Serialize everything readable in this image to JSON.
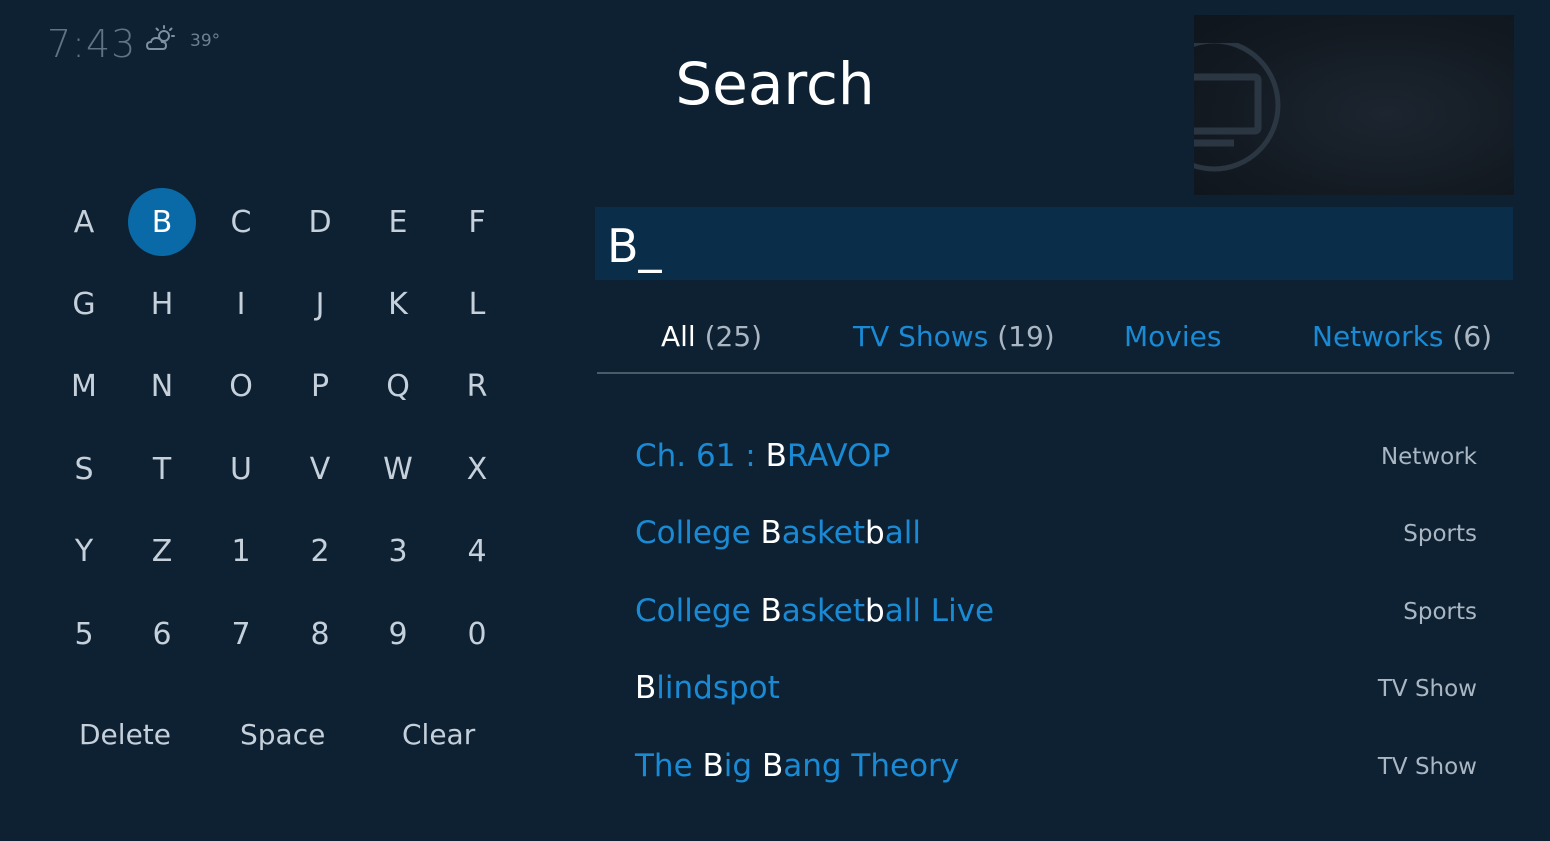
{
  "status": {
    "time": "7:43",
    "temperature": "39°",
    "weather_icon": "partly-cloudy-icon"
  },
  "page_title": "Search",
  "keyboard": {
    "keys": [
      "A",
      "B",
      "C",
      "D",
      "E",
      "F",
      "G",
      "H",
      "I",
      "J",
      "K",
      "L",
      "M",
      "N",
      "O",
      "P",
      "Q",
      "R",
      "S",
      "T",
      "U",
      "V",
      "W",
      "X",
      "Y",
      "Z",
      "1",
      "2",
      "3",
      "4",
      "5",
      "6",
      "7",
      "8",
      "9",
      "0"
    ],
    "selected_key": "B",
    "actions": {
      "delete": "Delete",
      "space": "Space",
      "clear": "Clear"
    }
  },
  "search": {
    "query": "B_"
  },
  "tabs": [
    {
      "label": "All",
      "count": "(25)",
      "selected": true
    },
    {
      "label": "TV Shows",
      "count": "(19)",
      "selected": false
    },
    {
      "label": "Movies",
      "count": "",
      "selected": false
    },
    {
      "label": "Networks",
      "count": "(6)",
      "selected": false
    }
  ],
  "results": [
    {
      "parts": [
        [
          "Ch. 61 : ",
          false
        ],
        [
          "B",
          true
        ],
        [
          "RAVOP",
          false
        ]
      ],
      "type": "Network"
    },
    {
      "parts": [
        [
          "College ",
          false
        ],
        [
          "B",
          true
        ],
        [
          "asket",
          false
        ],
        [
          "b",
          true
        ],
        [
          "all",
          false
        ]
      ],
      "type": "Sports"
    },
    {
      "parts": [
        [
          "College ",
          false
        ],
        [
          "B",
          true
        ],
        [
          "asket",
          false
        ],
        [
          "b",
          true
        ],
        [
          "all Live",
          false
        ]
      ],
      "type": "Sports"
    },
    {
      "parts": [
        [
          "B",
          true
        ],
        [
          "lindspot",
          false
        ]
      ],
      "type": "TV Show"
    },
    {
      "parts": [
        [
          "The ",
          false
        ],
        [
          "B",
          true
        ],
        [
          "ig ",
          false
        ],
        [
          "B",
          true
        ],
        [
          "ang Theory",
          false
        ]
      ],
      "type": "TV Show"
    }
  ],
  "colors": {
    "background": "#0d2133",
    "accent": "#1a8ad4",
    "selected_key": "#0a6aa8",
    "search_box": "#0a2d4a"
  }
}
